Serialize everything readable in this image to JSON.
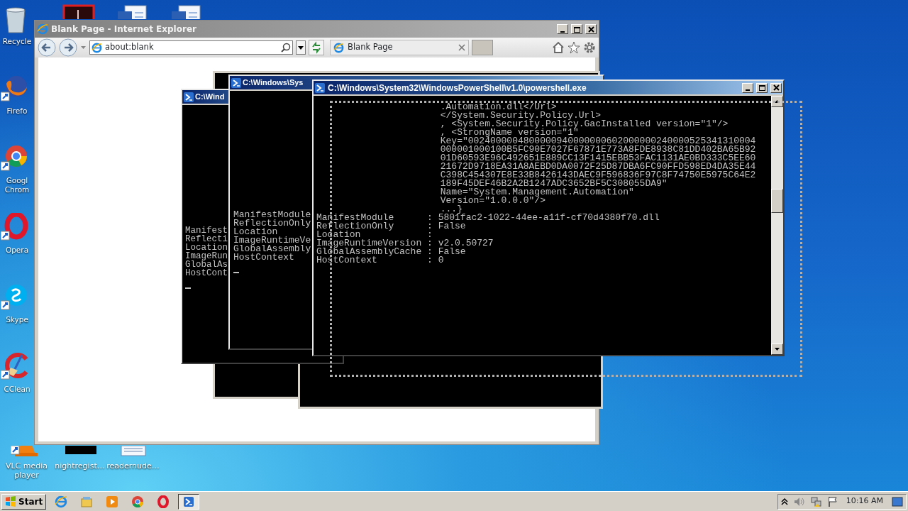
{
  "desktop": {
    "top_icons": [
      {
        "kind": "app"
      },
      {
        "kind": "word"
      },
      {
        "kind": "word"
      }
    ],
    "column_icons": [
      {
        "kind": "recycle",
        "label": "Recycle"
      },
      {
        "kind": "firefox",
        "label": "Firefo"
      },
      {
        "kind": "chrome",
        "label": "Googl Chrom"
      },
      {
        "kind": "opera",
        "label": "Opera"
      },
      {
        "kind": "skype",
        "label": "Skype"
      },
      {
        "kind": "ccleaner",
        "label": "CClean"
      }
    ],
    "bottom_icons": [
      {
        "kind": "vlc",
        "label": "VLC media player"
      },
      {
        "kind": "blank",
        "label": "nightregist…"
      },
      {
        "kind": "doc",
        "label": "readernude…"
      }
    ]
  },
  "browser": {
    "title": "Blank Page - Internet Explorer",
    "address": "about:blank",
    "tab": "Blank Page"
  },
  "consoles": [
    {
      "kind": "left",
      "title": "C:\\Wind",
      "cursor": true,
      "lines": [
        {
          "kind": "prop",
          "text": "Manifest"
        },
        {
          "kind": "prop",
          "text": "Reflecti"
        },
        {
          "kind": "prop",
          "text": "Location"
        },
        {
          "kind": "prop",
          "text": "ImageRun"
        },
        {
          "kind": "prop",
          "text": "GlobalAs"
        },
        {
          "kind": "prop",
          "text": "HostCont"
        }
      ]
    },
    {
      "kind": "middle",
      "title": "C:\\Windows\\Sys",
      "cursor": true,
      "lines": [
        {
          "kind": "prop",
          "text": "ManifestModule"
        },
        {
          "kind": "prop",
          "text": "ReflectionOnly"
        },
        {
          "kind": "prop",
          "text": "Location"
        },
        {
          "kind": "prop",
          "text": "ImageRuntimeVe"
        },
        {
          "kind": "prop",
          "text": "GlobalAssembly"
        },
        {
          "kind": "prop",
          "text": "HostContext"
        }
      ]
    },
    {
      "kind": "front",
      "title": "C:\\Windows\\System32\\WindowsPowerShell\\v1.0\\powershell.exe",
      "cursor": false,
      "lines": [
        {
          "kind": "cont",
          "text": ".Automation.dll</Url>"
        },
        {
          "kind": "cont",
          "text": "</System.Security.Policy.Url>"
        },
        {
          "kind": "cont",
          "text": ", <System.Security.Policy.GacInstalled version=\"1\"/>"
        },
        {
          "kind": "cont",
          "text": ", <StrongName version=\"1\""
        },
        {
          "kind": "cont",
          "text": "Key=\"0024000004800000940000000602000000240000525341310004"
        },
        {
          "kind": "cont",
          "text": "000001000100B5FC90E7027F67871E773A8FDE8938C81DD402BA65B92"
        },
        {
          "kind": "cont",
          "text": "01D60593E96C492651E889CC13F1415EBB53FAC1131AE0BD333C5EE60"
        },
        {
          "kind": "cont",
          "text": "21672D9718EA31A8AEBD0DA0072F25D87DBA6FC90FFD598ED4DA35E44"
        },
        {
          "kind": "cont",
          "text": "C398C454307E8E33B8426143DAEC9F596836F97C8F74750E5975C64E2"
        },
        {
          "kind": "cont",
          "text": "189F45DEF46B2A2B1247ADC3652BF5C308055DA9\""
        },
        {
          "kind": "cont",
          "text": "Name=\"System.Management.Automation\""
        },
        {
          "kind": "cont",
          "text": "Version=\"1.0.0.0\"/>"
        },
        {
          "kind": "cont",
          "text": "...}"
        },
        {
          "kind": "prop",
          "text": "ManifestModule      : 5801fac2-1022-44ee-a11f-cf70d4380f70.dll"
        },
        {
          "kind": "prop",
          "text": "ReflectionOnly      : False"
        },
        {
          "kind": "prop",
          "text": "Location            :"
        },
        {
          "kind": "prop",
          "text": "ImageRuntimeVersion : v2.0.50727"
        },
        {
          "kind": "prop",
          "text": "GlobalAssemblyCache : False"
        },
        {
          "kind": "prop",
          "text": "HostContext         : 0"
        }
      ]
    }
  ],
  "taskbar": {
    "start": "Start",
    "apps": [
      {
        "kind": "ie",
        "selected": false
      },
      {
        "kind": "explorer",
        "selected": false
      },
      {
        "kind": "media",
        "selected": false
      },
      {
        "kind": "chrome",
        "selected": false
      },
      {
        "kind": "opera",
        "selected": false
      },
      {
        "kind": "powershell",
        "selected": true
      }
    ],
    "clock": "10:16 AM"
  }
}
